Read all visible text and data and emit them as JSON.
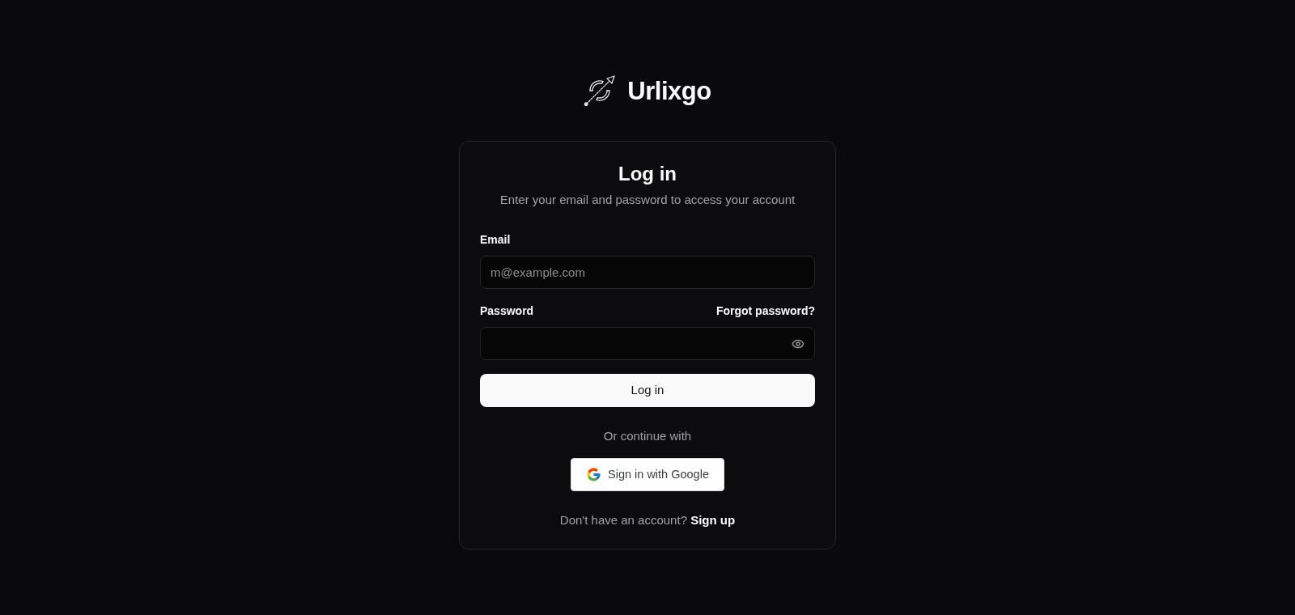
{
  "logo": {
    "name": "Urlixgo"
  },
  "card": {
    "title": "Log in",
    "subtitle": "Enter your email and password to access your account"
  },
  "fields": [
    {
      "kind": "text",
      "label": "Email",
      "placeholder": "m@example.com"
    },
    {
      "kind": "password",
      "label": "Password",
      "link": "Forgot password?"
    }
  ],
  "submit_button": "Log in",
  "divider_text": "Or continue with",
  "google_button": "Sign in with Google",
  "footer": {
    "text": "Don't have an account?",
    "link": "Sign up"
  }
}
